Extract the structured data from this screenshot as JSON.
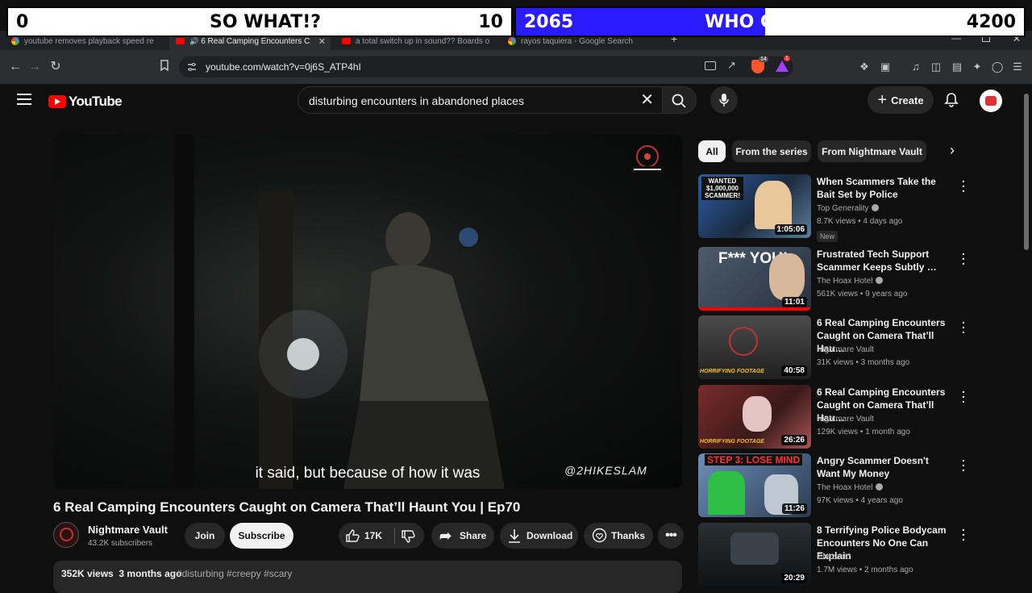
{
  "overlay": {
    "left_score": "0",
    "left_label": "SO WHAT!?",
    "left_max": "10",
    "right_score": "2065",
    "right_label": "WHO CARES!?",
    "right_max": "4200",
    "right_fill_fraction": 0.49,
    "right_fill_color": "#2a1bff"
  },
  "tabs": [
    {
      "label": "youtube removes playback speed re",
      "icon": "google-icon",
      "active": false
    },
    {
      "label": "6 Real Camping Encounters C",
      "icon": "youtube-icon",
      "active": true
    },
    {
      "label": "a total switch up in sound?? Boards o",
      "icon": "youtube-icon",
      "active": false
    },
    {
      "label": "rayos taquiera - Google Search",
      "icon": "google-icon",
      "active": false
    }
  ],
  "address": {
    "url": "youtube.com/watch?v=0j6S_ATP4hI",
    "brave_badge": "14",
    "alert_badge": "1"
  },
  "header": {
    "logo_text": "YouTube",
    "search_query": "disturbing encounters in abandoned places",
    "create_label": "Create"
  },
  "video": {
    "caption": "it said, but because of how it was",
    "watermark": "@2HIKESLAM",
    "title": "6 Real Camping Encounters Caught on Camera That’ll Haunt You | Ep70",
    "channel": "Nightmare Vault",
    "subscribers": "43.2K subscribers",
    "join_label": "Join",
    "subscribe_label": "Subscribe",
    "likes": "17K",
    "share_label": "Share",
    "download_label": "Download",
    "thanks_label": "Thanks",
    "views": "352K views",
    "age": "3 months ago",
    "tags": "#disturbing #creepy #scary"
  },
  "chips": [
    "All",
    "From the series",
    "From Nightmare Vault"
  ],
  "recommendations": [
    {
      "title": "When Scammers Take the Bait Set by Police",
      "channel": "Top Generality",
      "verified": true,
      "meta": "8.7K views • 4 days ago",
      "badge": "New",
      "duration": "1:05:06",
      "thumb_text": "WANTED $1,000,000 SCAMMER!"
    },
    {
      "title": "Frustrated Tech Support Scammer Keeps Subtly …",
      "channel": "The Hoax Hotel",
      "verified": true,
      "meta": "561K views • 9 years ago",
      "duration": "11:01",
      "thumb_text": "F*** YOU!"
    },
    {
      "title": "6 Real Camping Encounters Caught on Camera That’ll Hau…",
      "channel": "Nightmare Vault",
      "verified": false,
      "meta": "31K views • 3 months ago",
      "duration": "40:58",
      "thumb_text": "HORRIFYING FOOTAGE"
    },
    {
      "title": "6 Real Camping Encounters Caught on Camera That’ll Hau…",
      "channel": "Nightmare Vault",
      "verified": false,
      "meta": "129K views • 1 month ago",
      "duration": "26:26",
      "thumb_text": "HORRIFYING FOOTAGE"
    },
    {
      "title": "Angry Scammer Doesn't Want My Money",
      "channel": "The Hoax Hotel",
      "verified": true,
      "meta": "97K views • 4 years ago",
      "duration": "11:26",
      "thumb_text": "STEP 3: LOSE MIND"
    },
    {
      "title": "8 Terrifying Police Bodycam Encounters No One Can Explain",
      "channel": "Chezzoid",
      "verified": false,
      "meta": "1.7M views • 2 months ago",
      "duration": "20:29",
      "thumb_text": ""
    }
  ]
}
